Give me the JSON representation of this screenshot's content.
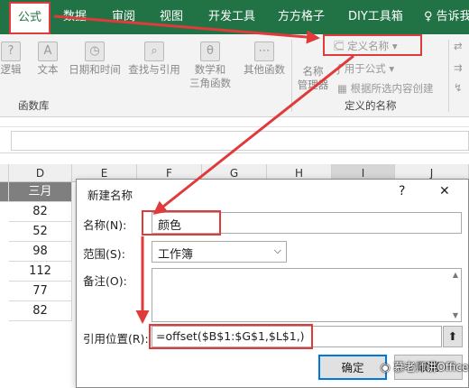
{
  "tabs": [
    {
      "label": "公式",
      "active": true
    },
    {
      "label": "数据"
    },
    {
      "label": "审阅"
    },
    {
      "label": "视图"
    },
    {
      "label": "开发工具"
    },
    {
      "label": "方方格子"
    },
    {
      "label": "DIY工具箱"
    },
    {
      "label": "告诉我"
    }
  ],
  "ribbon": {
    "functions": {
      "logic": "逻辑",
      "text": "文本",
      "datetime": "日期和时间",
      "lookup": "查找与引用",
      "math_line1": "数学和",
      "math_line2": "三角函数",
      "other": "其他函数",
      "group_label": "函数库"
    },
    "names": {
      "manager_line1": "名称",
      "manager_line2": "管理器",
      "define_name": "定义名称",
      "use_in_formula": "用于公式",
      "create_from_selection": "根据所选内容创建",
      "group_label": "定义的名称"
    }
  },
  "sheet": {
    "columns": [
      "D",
      "E",
      "F",
      "G",
      "H",
      "I",
      "J"
    ],
    "header_cell": "三月",
    "d_values": [
      "82",
      "52",
      "98",
      "112",
      "77",
      "82"
    ]
  },
  "dialog": {
    "title": "新建名称",
    "help": "?",
    "close": "✕",
    "name_label": "名称(N):",
    "name_value": "颜色",
    "scope_label": "范围(S):",
    "scope_value": "工作簿",
    "comment_label": "备注(O):",
    "comment_value": "",
    "refers_label": "引用位置(R):",
    "refers_value": "=offset($B$1:$G$1,$L$1,)",
    "ok_label": "确定",
    "cancel_label": "取消"
  },
  "watermark": "慕老师讲Office",
  "colors": {
    "excel_green": "#217346",
    "highlight_red": "#e03a3a"
  }
}
